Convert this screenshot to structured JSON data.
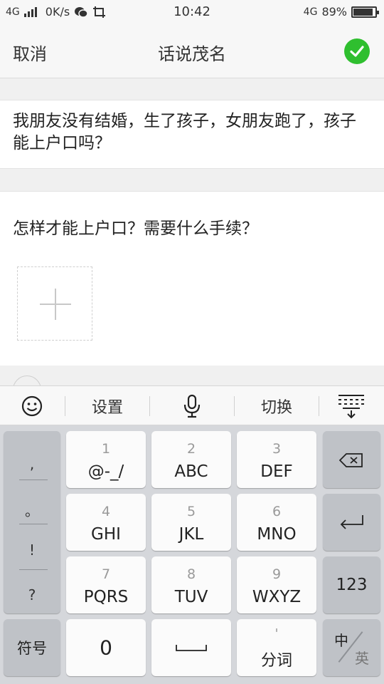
{
  "status_bar": {
    "network_left": "4G",
    "speed": "0K/s",
    "time": "10:42",
    "network_right": "4G",
    "battery": "89%",
    "battery_level": 0.89
  },
  "header": {
    "cancel": "取消",
    "title": "话说茂名",
    "confirm_icon": "check-circle-icon",
    "accent": "#2fbf2f"
  },
  "question": {
    "text": "我朋友没有结婚，生了孩子，女朋友跑了，孩子能上户口吗？"
  },
  "detail": {
    "text": "怎样才能上户口？需要什么手续？",
    "add_icon": "plus-icon"
  },
  "keyboard_toolbar": {
    "emoji_icon": "smiley-icon",
    "settings": "设置",
    "mic_icon": "microphone-icon",
    "switch": "切换",
    "hide_icon": "keyboard-hide-icon"
  },
  "keyboard": {
    "punctuation": [
      ",",
      "。",
      "!",
      "?"
    ],
    "keys": [
      {
        "num": "1",
        "label": "@-_/"
      },
      {
        "num": "2",
        "label": "ABC"
      },
      {
        "num": "3",
        "label": "DEF"
      },
      {
        "num": "4",
        "label": "GHI"
      },
      {
        "num": "5",
        "label": "JKL"
      },
      {
        "num": "6",
        "label": "MNO"
      },
      {
        "num": "7",
        "label": "PQRS"
      },
      {
        "num": "8",
        "label": "TUV"
      },
      {
        "num": "9",
        "label": "WXYZ"
      }
    ],
    "symbols": "符号",
    "zero": "0",
    "fenci_top": "'",
    "fenci": "分词",
    "num_key": "123",
    "lang_zh": "中",
    "lang_en": "英"
  }
}
